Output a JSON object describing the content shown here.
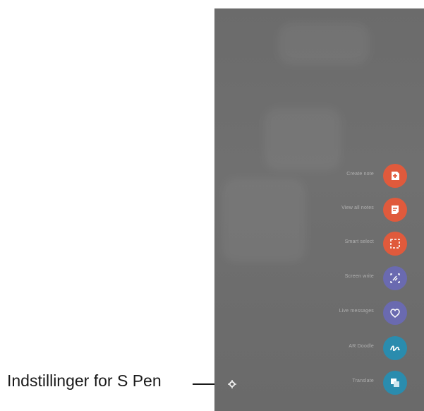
{
  "callout": {
    "label": "Indstillinger for S Pen"
  },
  "air_command": {
    "items": [
      {
        "label": "Create note",
        "icon": "create-note-icon",
        "color": "#e05a3c"
      },
      {
        "label": "View all notes",
        "icon": "view-all-notes-icon",
        "color": "#e05a3c"
      },
      {
        "label": "Smart select",
        "icon": "smart-select-icon",
        "color": "#e05a3c"
      },
      {
        "label": "Screen write",
        "icon": "screen-write-icon",
        "color": "#6a6ab0"
      },
      {
        "label": "Live messages",
        "icon": "live-messages-icon",
        "color": "#6a6ab0"
      },
      {
        "label": "AR Doodle",
        "icon": "ar-doodle-icon",
        "color": "#2a8cae"
      },
      {
        "label": "Translate",
        "icon": "translate-icon",
        "color": "#2a8cae"
      }
    ]
  }
}
